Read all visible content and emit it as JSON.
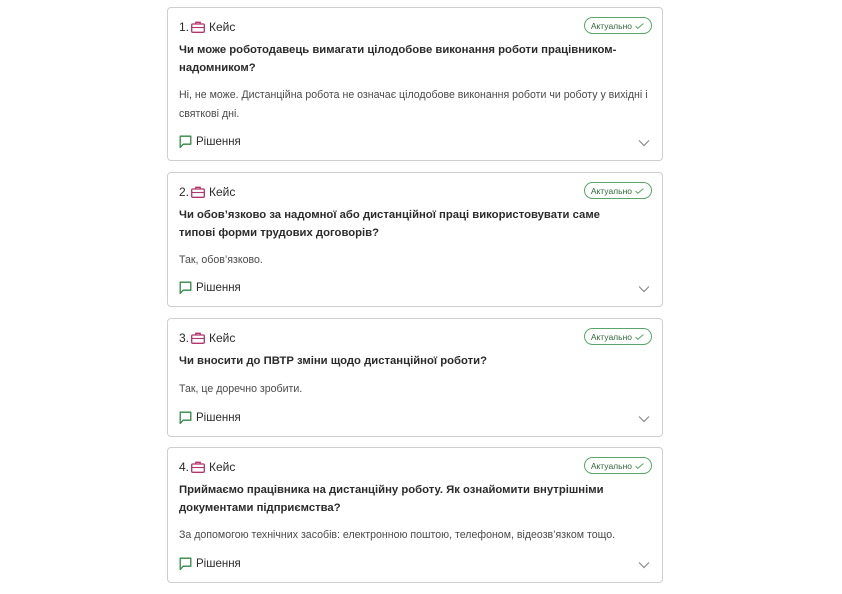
{
  "cards": [
    {
      "number": "1.",
      "label": "Кейс",
      "badge": "Актуально",
      "question": "Чи може роботодавець вимагати цілодобове виконання роботи працівником-надомником?",
      "answer": "Ні, не може. Дистанційна робота не означає цілодобове виконання роботи чи роботу у вихідні і святкові дні.",
      "solution": "Рішення"
    },
    {
      "number": "2.",
      "label": "Кейс",
      "badge": "Актуально",
      "question": "Чи обов’язково за надомної або дистанційної праці використовувати саме типові форми трудових договорів?",
      "answer": "Так, обов’язково.",
      "solution": "Рішення"
    },
    {
      "number": "3.",
      "label": "Кейс",
      "badge": "Актуально",
      "question": "Чи вносити до ПВТР зміни щодо дистанційної роботи?",
      "answer": "Так, це доречно зробити.",
      "solution": "Рішення"
    },
    {
      "number": "4.",
      "label": "Кейс",
      "badge": "Актуально",
      "question": "Приймаємо працівника на дистанційну роботу. Як ознайомити внутрішніми документами підприємства?",
      "answer": "За допомогою технічних засобів: електронною поштою, телефоном, відеозв’язком тощо.",
      "solution": "Рішення"
    }
  ],
  "colors": {
    "case_icon": "#b3336b",
    "badge_border": "#5aa56c",
    "solution_icon": "#2e8a45"
  },
  "icons": {
    "case": "briefcase-icon",
    "badge_check": "check-icon",
    "solution": "flag-icon",
    "expand": "chevron-down-icon"
  }
}
